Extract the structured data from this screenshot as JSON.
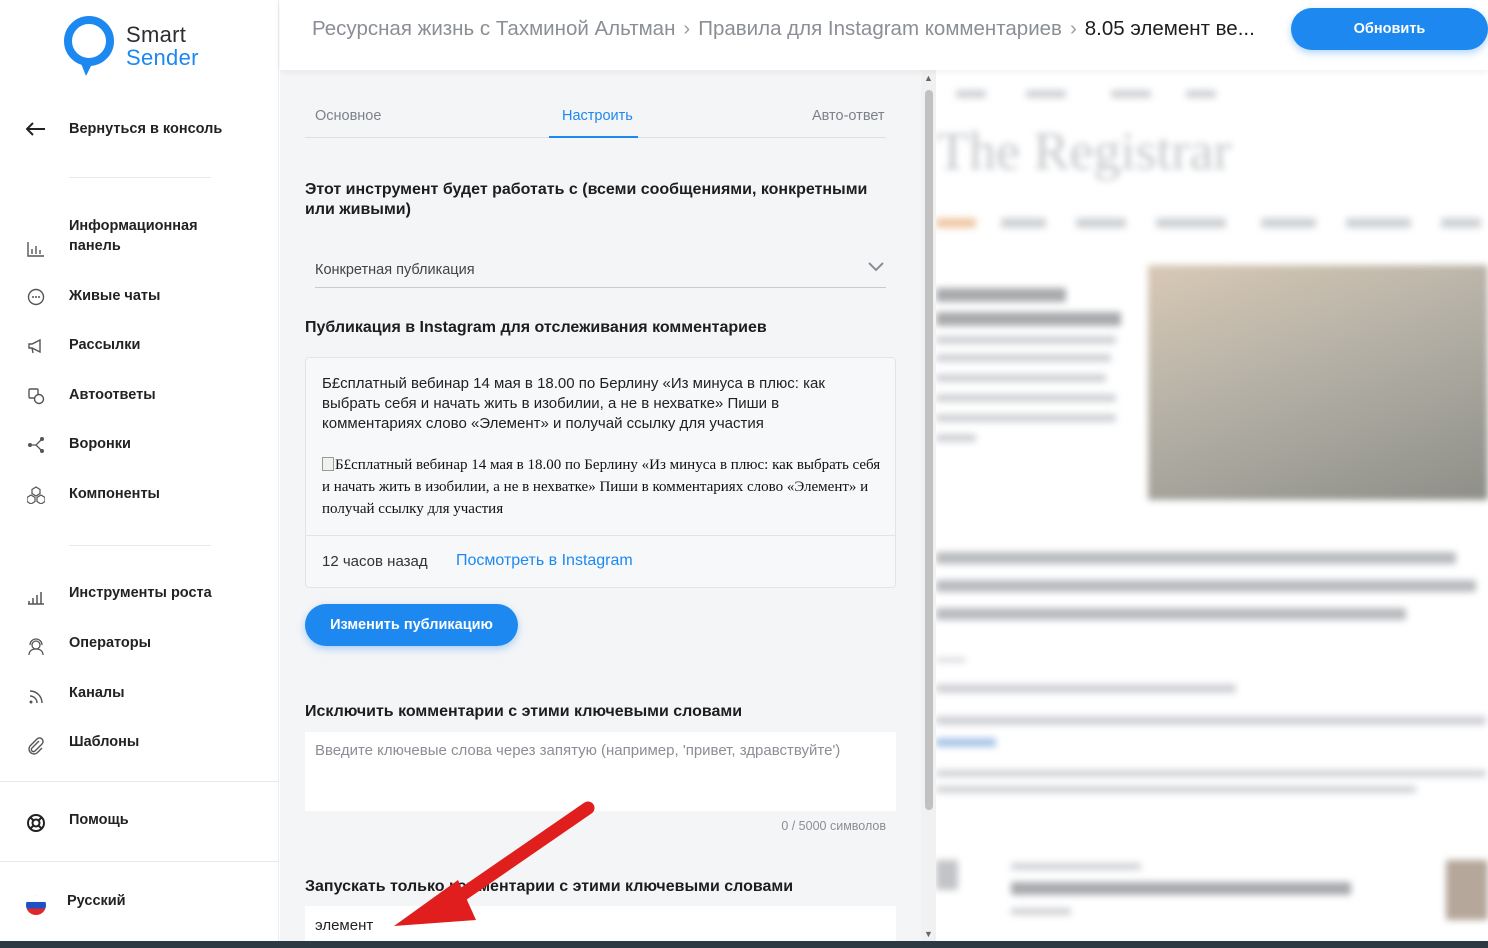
{
  "brand": {
    "line1": "Smart",
    "line2": "Sender",
    "color": "#1d88f0"
  },
  "sidebar": {
    "back": "Вернуться в консоль",
    "items": [
      {
        "label": "Информационная панель",
        "icon": "bar-chart-icon"
      },
      {
        "label": "Живые чаты",
        "icon": "chat-bubble-icon"
      },
      {
        "label": "Рассылки",
        "icon": "megaphone-icon"
      },
      {
        "label": "Автоответы",
        "icon": "auto-reply-icon"
      },
      {
        "label": "Воронки",
        "icon": "funnel-icon"
      },
      {
        "label": "Компоненты",
        "icon": "components-icon"
      }
    ],
    "tools": [
      {
        "label": "Инструменты роста",
        "icon": "growth-icon"
      },
      {
        "label": "Операторы",
        "icon": "operator-icon"
      },
      {
        "label": "Каналы",
        "icon": "rss-icon"
      },
      {
        "label": "Шаблоны",
        "icon": "paperclip-icon"
      }
    ],
    "help": "Помощь",
    "language": "Русский"
  },
  "header": {
    "crumbs": [
      "Ресурсная жизнь с Тахминой Альтман",
      "Правила для Instagram комментариев"
    ],
    "current": "8.05 элемент ве...",
    "update_button": "Обновить"
  },
  "tabs": [
    "Основное",
    "Настроить",
    "Авто-ответ"
  ],
  "active_tab": "Настроить",
  "form": {
    "scope_heading": "Этот инструмент будет работать с (всеми сообщениями, конкретными или живыми)",
    "scope_value": "Конкретная публикация",
    "publication_heading": "Публикация в Instagram для отслеживания комментариев",
    "post_text": "Б£сплатный вебинар 14 мая в 18.00 по Берлину «Из минуса в плюс: как выбрать себя и начать жить в изобилии, а не в нехватке» Пиши в комментариях слово «Элемент» и получай ссылку для участия",
    "post_alt": "Б£сплатный вебинар 14 мая в 18.00 по Берлину «Из минуса в плюс: как выбрать себя и начать жить в изобилии, а не в нехватке» Пиши в комментариях слово «Элемент» и получай ссылку для участия",
    "post_time": "12 часов назад",
    "view_link": "Посмотреть в Instagram",
    "change_button": "Изменить публикацию",
    "exclude_heading": "Исключить комментарии с этими ключевыми словами",
    "exclude_placeholder": "Введите ключевые слова через запятую (например, 'привет, здравствуйте')",
    "counter": "0 / 5000 символов",
    "include_heading": "Запускать только комментарии с этими ключевыми словами",
    "include_value": "элемент"
  }
}
